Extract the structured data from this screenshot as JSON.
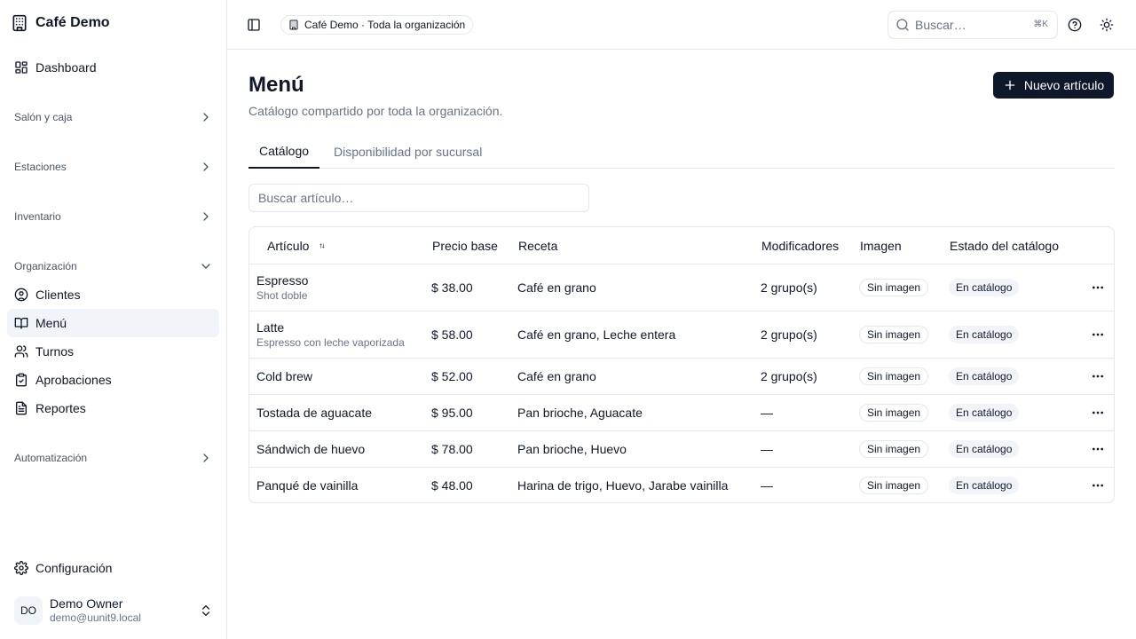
{
  "sidebar": {
    "brand": "Café Demo",
    "dashboard": "Dashboard",
    "groups": {
      "salon": "Salón y caja",
      "estaciones": "Estaciones",
      "inventario": "Inventario",
      "organizacion": "Organización",
      "automatizacion": "Automatización"
    },
    "items": {
      "clientes": "Clientes",
      "menu": "Menú",
      "turnos": "Turnos",
      "aprobaciones": "Aprobaciones",
      "reportes": "Reportes"
    },
    "settings": "Configuración",
    "user": {
      "initials": "DO",
      "name": "Demo Owner",
      "email": "demo@uunit9.local"
    }
  },
  "header": {
    "org_scope": "Café Demo · Toda la organización",
    "search_placeholder": "Buscar…",
    "search_shortcut": "⌘K"
  },
  "page": {
    "title": "Menú",
    "subtitle": "Catálogo compartido por toda la organización.",
    "new_button": "Nuevo artículo",
    "tabs": [
      "Catálogo",
      "Disponibilidad por sucursal"
    ],
    "filter_placeholder": "Buscar artículo…"
  },
  "table": {
    "headers": [
      "Artículo",
      "Precio base",
      "Receta",
      "Modificadores",
      "Imagen",
      "Estado del catálogo"
    ],
    "rows": [
      {
        "name": "Espresso",
        "desc": "Shot doble",
        "price": "$ 38.00",
        "recipe": "Café en grano",
        "modifiers": "2 grupo(s)",
        "image": "Sin imagen",
        "status": "En catálogo"
      },
      {
        "name": "Latte",
        "desc": "Espresso con leche vaporizada",
        "price": "$ 58.00",
        "recipe": "Café en grano, Leche entera",
        "modifiers": "2 grupo(s)",
        "image": "Sin imagen",
        "status": "En catálogo"
      },
      {
        "name": "Cold brew",
        "desc": "",
        "price": "$ 52.00",
        "recipe": "Café en grano",
        "modifiers": "2 grupo(s)",
        "image": "Sin imagen",
        "status": "En catálogo"
      },
      {
        "name": "Tostada de aguacate",
        "desc": "",
        "price": "$ 95.00",
        "recipe": "Pan brioche, Aguacate",
        "modifiers": "—",
        "image": "Sin imagen",
        "status": "En catálogo"
      },
      {
        "name": "Sándwich de huevo",
        "desc": "",
        "price": "$ 78.00",
        "recipe": "Pan brioche, Huevo",
        "modifiers": "—",
        "image": "Sin imagen",
        "status": "En catálogo"
      },
      {
        "name": "Panqué de vainilla",
        "desc": "",
        "price": "$ 48.00",
        "recipe": "Harina de trigo, Huevo, Jarabe vainilla",
        "modifiers": "—",
        "image": "Sin imagen",
        "status": "En catálogo"
      }
    ]
  },
  "colors": {
    "primary": "#0f172a",
    "muted": "#64748b",
    "border": "#e5e7eb",
    "active_bg": "#f1f5f9"
  }
}
